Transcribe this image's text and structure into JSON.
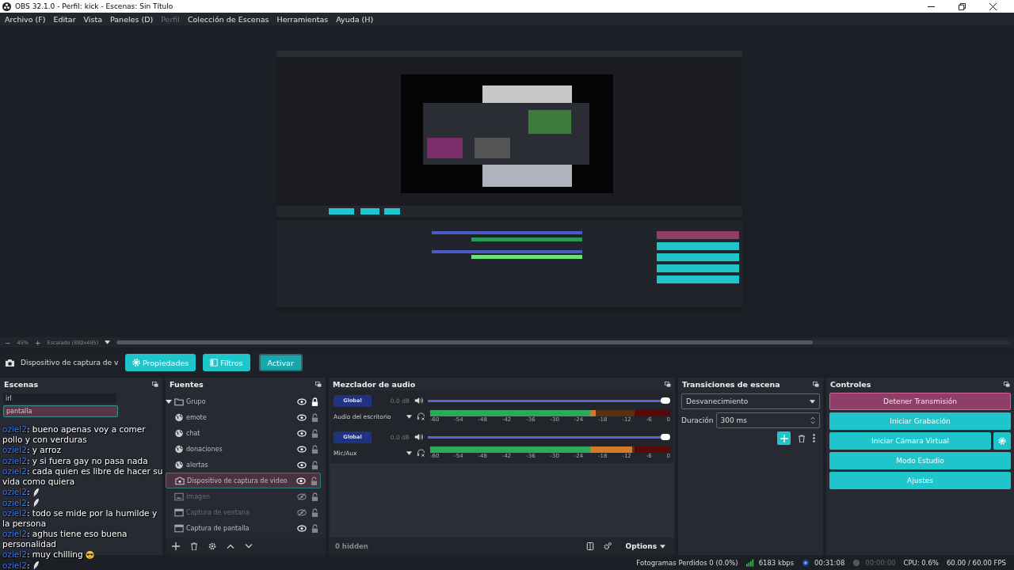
{
  "window": {
    "title": "OBS 32.1.0 - Perfil: kick - Escenas: Sin Título"
  },
  "menu": [
    {
      "label": "Archivo (F)",
      "disabled": false
    },
    {
      "label": "Editar",
      "disabled": false
    },
    {
      "label": "Vista",
      "disabled": false
    },
    {
      "label": "Paneles (D)",
      "disabled": false
    },
    {
      "label": "Perfil",
      "disabled": true
    },
    {
      "label": "Colección de Escenas",
      "disabled": false
    },
    {
      "label": "Herramientas",
      "disabled": false
    },
    {
      "label": "Ayuda (H)",
      "disabled": false
    }
  ],
  "zoom_bar": {
    "minus": "−",
    "zoom": "45%",
    "plus": "+",
    "scaling": "Escalado (880x495)"
  },
  "context_bar": {
    "source": "Dispositivo de captura de v",
    "buttons": [
      {
        "label": "Propiedades",
        "kind": "gear"
      },
      {
        "label": "Filtros",
        "kind": "filter"
      },
      {
        "label": "Activar",
        "kind": "outline"
      }
    ]
  },
  "scenes": {
    "title": "Escenas",
    "items": [
      {
        "name": "irl",
        "selected": false
      },
      {
        "name": "pantalla",
        "selected": true
      }
    ]
  },
  "sources": {
    "title": "Fuentes",
    "items": [
      {
        "name": "Grupo",
        "kind": "group",
        "expanded": true,
        "visible": true,
        "locked": true,
        "selected": false,
        "children": [
          {
            "name": "emote",
            "kind": "browser",
            "visible": true,
            "locked": false,
            "selected": false
          },
          {
            "name": "chat",
            "kind": "browser",
            "visible": true,
            "locked": false,
            "selected": false
          },
          {
            "name": "donaciones",
            "kind": "browser",
            "visible": true,
            "locked": false,
            "selected": false
          },
          {
            "name": "alertas",
            "kind": "browser",
            "visible": true,
            "locked": false,
            "selected": false
          }
        ]
      },
      {
        "name": "Dispositivo de captura de video",
        "kind": "camera",
        "visible": true,
        "locked": false,
        "selected": true
      },
      {
        "name": "Imagen",
        "kind": "image",
        "visible": false,
        "locked": false,
        "selected": false
      },
      {
        "name": "Captura de ventana",
        "kind": "window",
        "visible": false,
        "locked": false,
        "selected": false
      },
      {
        "name": "Captura de pantalla",
        "kind": "window",
        "visible": true,
        "locked": false,
        "selected": false
      }
    ]
  },
  "mixer": {
    "title": "Mezclador de audio",
    "channels": [
      {
        "name": "Audio del escritorio",
        "mode": "Global",
        "db": "0.0 dB",
        "volume": {
          "level": 1
        },
        "meter": {
          "level": 0.69
        },
        "ticks": [
          "-60",
          "-54",
          "-48",
          "-42",
          "-36",
          "-30",
          "-24",
          "-18",
          "-12",
          "-6",
          "0"
        ]
      },
      {
        "name": "Mic/Aux",
        "mode": "Global",
        "db": "0.0 dB",
        "volume": {
          "level": 1
        },
        "meter": {
          "level": 0.84
        },
        "ticks": [
          "-60",
          "-54",
          "-48",
          "-42",
          "-36",
          "-30",
          "-24",
          "-18",
          "-12",
          "-6",
          "0"
        ]
      }
    ],
    "hidden": "0 hidden",
    "options": "Options"
  },
  "transitions": {
    "title": "Transiciones de escena",
    "transition": "Desvanecimiento",
    "duration_label": "Duración",
    "duration": "300 ms"
  },
  "controls": {
    "title": "Controles",
    "buttons": [
      {
        "label": "Detener Transmisión",
        "kind": "stop"
      },
      {
        "label": "Iniciar Grabación",
        "kind": "normal"
      },
      {
        "label": "Iniciar Cámara Virtual",
        "kind": "virtualcam"
      },
      {
        "label": "Modo Estudio",
        "kind": "normal"
      },
      {
        "label": "Ajustes",
        "kind": "normal"
      }
    ]
  },
  "status_bar": {
    "dropped": "Fotogramas Perdidos 0 (0.0%)",
    "bitrate": "6183 kbps",
    "streaming": true,
    "stream_time": "00:31:08",
    "recording": false,
    "record_time": "00:00:00",
    "cpu": "CPU: 0.6%",
    "fps": "60.00 / 60.00 FPS"
  },
  "chat": {
    "messages": [
      {
        "user": "oziel2",
        "text": ": bueno apenas voy a comer pollo y con verduras",
        "kind": "text"
      },
      {
        "user": "oziel2",
        "text": ": y arroz",
        "kind": "text"
      },
      {
        "user": "oziel2",
        "text": ": y si fuera gay no pasa nada",
        "kind": "text"
      },
      {
        "user": "oziel2",
        "text": ": cada quien es libre de hacer su vida como quiera",
        "kind": "text"
      },
      {
        "user": "oziel2",
        "text": ":",
        "kind": "feather"
      },
      {
        "user": "oziel2",
        "text": ":",
        "kind": "feather"
      },
      {
        "user": "oziel2",
        "text": ": todo se mide por la humilde y la persona",
        "kind": "text"
      },
      {
        "user": "oziel2",
        "text": ": aghus tiene eso buena personalidad",
        "kind": "text"
      },
      {
        "user": "oziel2",
        "text": ": muy chilling",
        "kind": "sunglasses"
      },
      {
        "user": "oziel2",
        "text": ":",
        "kind": "feather"
      }
    ]
  }
}
